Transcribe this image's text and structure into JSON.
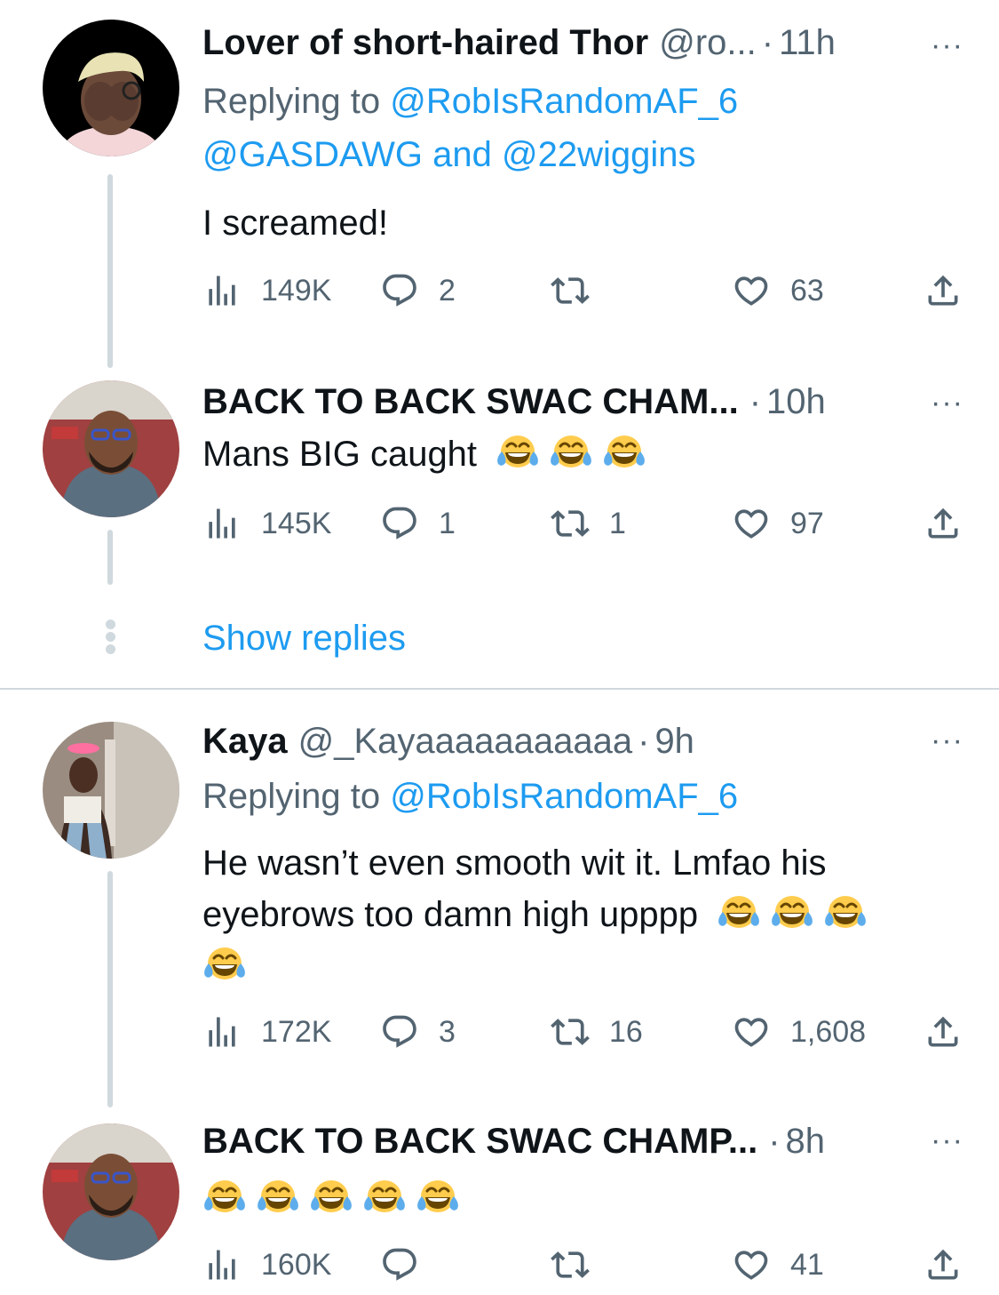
{
  "colors": {
    "link": "#1d9bf0",
    "secondary": "#536471",
    "text": "#0f1419",
    "line": "#cfd9de"
  },
  "icons": {
    "views": "bar-chart-icon",
    "reply": "speech-bubble-icon",
    "retweet": "retweet-arrows-icon",
    "like": "heart-icon",
    "share": "share-upload-icon",
    "more": "ellipsis-icon",
    "emoji": "face-with-tears-of-joy-emoji"
  },
  "tweets": [
    {
      "name": "Lover of short-haired Thor",
      "handle": "@ro...",
      "dot": "·",
      "time": "11h",
      "more": "···",
      "replying_label": "Replying to",
      "replying_user": "@RobIsRandomAF_6",
      "replying_line2_a": "@GASDAWG",
      "replying_and": "and",
      "replying_line2_b": "@22wiggins",
      "text": "I screamed!",
      "views": "149K",
      "replies": "2",
      "retweets": "",
      "likes": "63"
    },
    {
      "name": "BACK TO BACK SWAC CHAM...",
      "dot": "·",
      "time": "10h",
      "more": "···",
      "text": "Mans BIG caught",
      "emoji_count": 3,
      "views": "145K",
      "replies": "1",
      "retweets": "1",
      "likes": "97"
    },
    {
      "name": "Kaya",
      "handle": "@_Kayaaaaaaaaaaa",
      "dot": "·",
      "time": "9h",
      "more": "···",
      "replying_label": "Replying to",
      "replying_user": "@RobIsRandomAF_6",
      "text_line1": "He wasn’t even smooth wit it. Lmfao his",
      "text_line2": "eyebrows too damn high upppp",
      "emoji_count": 4,
      "views": "172K",
      "replies": "3",
      "retweets": "16",
      "likes": "1,608"
    },
    {
      "name": "BACK TO BACK SWAC CHAMP...",
      "dot": "·",
      "time": "8h",
      "more": "···",
      "emoji_count": 5,
      "views": "160K",
      "replies": "",
      "retweets": "",
      "likes": "41"
    }
  ],
  "show_replies": "Show replies"
}
